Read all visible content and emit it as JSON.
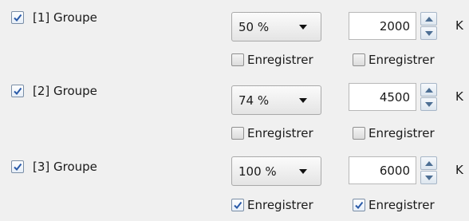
{
  "groups": [
    {
      "label": "[1] Groupe",
      "checked": true,
      "percent": "50 %",
      "value": "2000",
      "unit": "K",
      "record_a": {
        "label": "Enregistrer",
        "checked": false
      },
      "record_b": {
        "label": "Enregistrer",
        "checked": false
      }
    },
    {
      "label": "[2] Groupe",
      "checked": true,
      "percent": "74 %",
      "value": "4500",
      "unit": "K",
      "record_a": {
        "label": "Enregistrer",
        "checked": false
      },
      "record_b": {
        "label": "Enregistrer",
        "checked": false
      }
    },
    {
      "label": "[3] Groupe",
      "checked": true,
      "percent": "100 %",
      "value": "6000",
      "unit": "K",
      "record_a": {
        "label": "Enregistrer",
        "checked": true
      },
      "record_b": {
        "label": "Enregistrer",
        "checked": true
      }
    }
  ],
  "colors": {
    "check": "#2a5aa8",
    "background": "#f0f0f0"
  }
}
